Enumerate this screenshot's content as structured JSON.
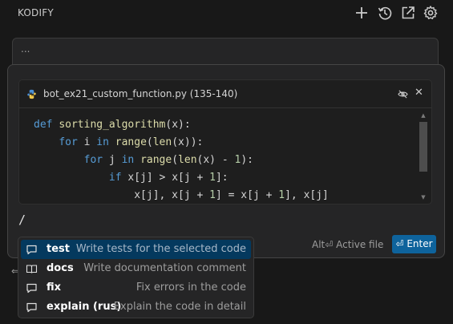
{
  "app": {
    "title": "KODIFY"
  },
  "header_icons": [
    "plus-icon",
    "history-icon",
    "open-external-icon",
    "gear-icon"
  ],
  "previous_message": {
    "text": "..."
  },
  "code_context": {
    "file_label": "bot_ex21_custom_function.py (135-140)",
    "lines": [
      "def sorting_algorithm(x):",
      "    for i in range(len(x)):",
      "        for j in range(len(x) - 1):",
      "            if x[j] > x[j + 1]:",
      "                x[j], x[j + 1] = x[j + 1], x[j]"
    ]
  },
  "input": {
    "value": "/"
  },
  "footer": {
    "active_file_label": "Alt⏎ Active file",
    "enter_label": "⏎ Enter"
  },
  "commands": [
    {
      "name": "test",
      "description": "Write tests for the selected code",
      "selected": true
    },
    {
      "name": "docs",
      "description": "Write documentation comment",
      "selected": false
    },
    {
      "name": "fix",
      "description": "Fix errors in the code",
      "selected": false
    },
    {
      "name": "explain (rus)",
      "description": "Explain the code in detail",
      "selected": false
    }
  ],
  "colors": {
    "accent": "#0e639c",
    "selected": "#04395e",
    "keyword": "#569cd6",
    "function": "#dcdcaa",
    "number": "#b5cea8"
  }
}
